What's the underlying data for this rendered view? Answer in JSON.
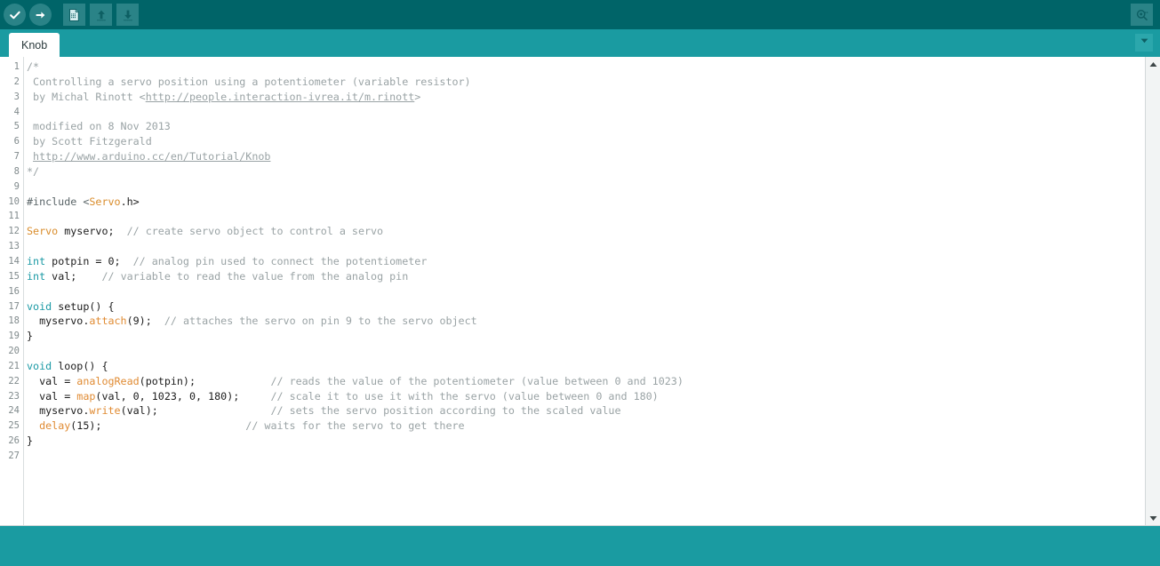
{
  "window": {
    "title": "Arduino IDE",
    "theme_accent": "#006468",
    "theme_tabbar": "#1a9ba1",
    "theme_button": "#2a8387"
  },
  "toolbar": {
    "buttons": [
      {
        "name": "verify-button",
        "label": "Verify",
        "icon": "check-icon",
        "shape": "round"
      },
      {
        "name": "upload-button",
        "label": "Upload",
        "icon": "arrow-right-icon",
        "shape": "round"
      },
      {
        "name": "new-button",
        "label": "New",
        "icon": "document-icon",
        "shape": "square"
      },
      {
        "name": "open-button",
        "label": "Open",
        "icon": "arrow-up-icon",
        "shape": "square"
      },
      {
        "name": "save-button",
        "label": "Save",
        "icon": "arrow-down-icon",
        "shape": "square"
      }
    ],
    "serial_monitor": {
      "label": "Serial Monitor",
      "icon": "serial-monitor-icon"
    }
  },
  "tabbar": {
    "tabs": [
      {
        "label": "Knob",
        "active": true
      }
    ],
    "menu_icon": "chevron-down-icon"
  },
  "editor": {
    "line_count": 27,
    "line_numbers": [
      1,
      2,
      3,
      4,
      5,
      6,
      7,
      8,
      9,
      10,
      11,
      12,
      13,
      14,
      15,
      16,
      17,
      18,
      19,
      20,
      21,
      22,
      23,
      24,
      25,
      26,
      27
    ],
    "lines": [
      {
        "n": 1,
        "tokens": [
          {
            "t": "comment",
            "v": "/*"
          }
        ]
      },
      {
        "n": 2,
        "tokens": [
          {
            "t": "comment",
            "v": " Controlling a servo position using a potentiometer (variable resistor)"
          }
        ]
      },
      {
        "n": 3,
        "tokens": [
          {
            "t": "comment",
            "v": " by Michal Rinott <"
          },
          {
            "t": "comment-link",
            "v": "http://people.interaction-ivrea.it/m.rinott"
          },
          {
            "t": "comment",
            "v": ">"
          }
        ]
      },
      {
        "n": 4,
        "tokens": []
      },
      {
        "n": 5,
        "tokens": [
          {
            "t": "comment",
            "v": " modified on 8 Nov 2013"
          }
        ]
      },
      {
        "n": 6,
        "tokens": [
          {
            "t": "comment",
            "v": " by Scott Fitzgerald"
          }
        ]
      },
      {
        "n": 7,
        "tokens": [
          {
            "t": "comment",
            "v": " "
          },
          {
            "t": "comment-link",
            "v": "http://www.arduino.cc/en/Tutorial/Knob"
          }
        ]
      },
      {
        "n": 8,
        "tokens": [
          {
            "t": "comment",
            "v": "*/"
          }
        ]
      },
      {
        "n": 9,
        "tokens": []
      },
      {
        "n": 10,
        "tokens": [
          {
            "t": "preproc",
            "v": "#include <"
          },
          {
            "t": "type",
            "v": "Servo"
          },
          {
            "t": "plain",
            "v": ".h>"
          }
        ]
      },
      {
        "n": 11,
        "tokens": []
      },
      {
        "n": 12,
        "tokens": [
          {
            "t": "type",
            "v": "Servo"
          },
          {
            "t": "plain",
            "v": " myservo;  "
          },
          {
            "t": "comment",
            "v": "// create servo object to control a servo"
          }
        ]
      },
      {
        "n": 13,
        "tokens": []
      },
      {
        "n": 14,
        "tokens": [
          {
            "t": "keyword",
            "v": "int"
          },
          {
            "t": "plain",
            "v": " potpin = 0;  "
          },
          {
            "t": "comment",
            "v": "// analog pin used to connect the potentiometer"
          }
        ]
      },
      {
        "n": 15,
        "tokens": [
          {
            "t": "keyword",
            "v": "int"
          },
          {
            "t": "plain",
            "v": " val;    "
          },
          {
            "t": "comment",
            "v": "// variable to read the value from the analog pin"
          }
        ]
      },
      {
        "n": 16,
        "tokens": []
      },
      {
        "n": 17,
        "tokens": [
          {
            "t": "keyword",
            "v": "void"
          },
          {
            "t": "plain",
            "v": " setup() {"
          }
        ]
      },
      {
        "n": 18,
        "tokens": [
          {
            "t": "plain",
            "v": "  myservo."
          },
          {
            "t": "func",
            "v": "attach"
          },
          {
            "t": "plain",
            "v": "(9);  "
          },
          {
            "t": "comment",
            "v": "// attaches the servo on pin 9 to the servo object"
          }
        ]
      },
      {
        "n": 19,
        "tokens": [
          {
            "t": "plain",
            "v": "}"
          }
        ]
      },
      {
        "n": 20,
        "tokens": []
      },
      {
        "n": 21,
        "tokens": [
          {
            "t": "keyword",
            "v": "void"
          },
          {
            "t": "plain",
            "v": " loop() {"
          }
        ]
      },
      {
        "n": 22,
        "tokens": [
          {
            "t": "plain",
            "v": "  val = "
          },
          {
            "t": "func",
            "v": "analogRead"
          },
          {
            "t": "plain",
            "v": "(potpin);            "
          },
          {
            "t": "comment",
            "v": "// reads the value of the potentiometer (value between 0 and 1023)"
          }
        ]
      },
      {
        "n": 23,
        "tokens": [
          {
            "t": "plain",
            "v": "  val = "
          },
          {
            "t": "func",
            "v": "map"
          },
          {
            "t": "plain",
            "v": "(val, 0, 1023, 0, 180);     "
          },
          {
            "t": "comment",
            "v": "// scale it to use it with the servo (value between 0 and 180)"
          }
        ]
      },
      {
        "n": 24,
        "tokens": [
          {
            "t": "plain",
            "v": "  myservo."
          },
          {
            "t": "func",
            "v": "write"
          },
          {
            "t": "plain",
            "v": "(val);                  "
          },
          {
            "t": "comment",
            "v": "// sets the servo position according to the scaled value"
          }
        ]
      },
      {
        "n": 25,
        "tokens": [
          {
            "t": "plain",
            "v": "  "
          },
          {
            "t": "func",
            "v": "delay"
          },
          {
            "t": "plain",
            "v": "(15);                       "
          },
          {
            "t": "comment",
            "v": "// waits for the servo to get there"
          }
        ]
      },
      {
        "n": 26,
        "tokens": [
          {
            "t": "plain",
            "v": "}"
          }
        ]
      },
      {
        "n": 27,
        "tokens": []
      }
    ]
  },
  "scrollbar": {
    "up_icon": "scroll-up-arrow-icon",
    "down_icon": "scroll-down-arrow-icon"
  },
  "statusbar": {
    "text": ""
  }
}
